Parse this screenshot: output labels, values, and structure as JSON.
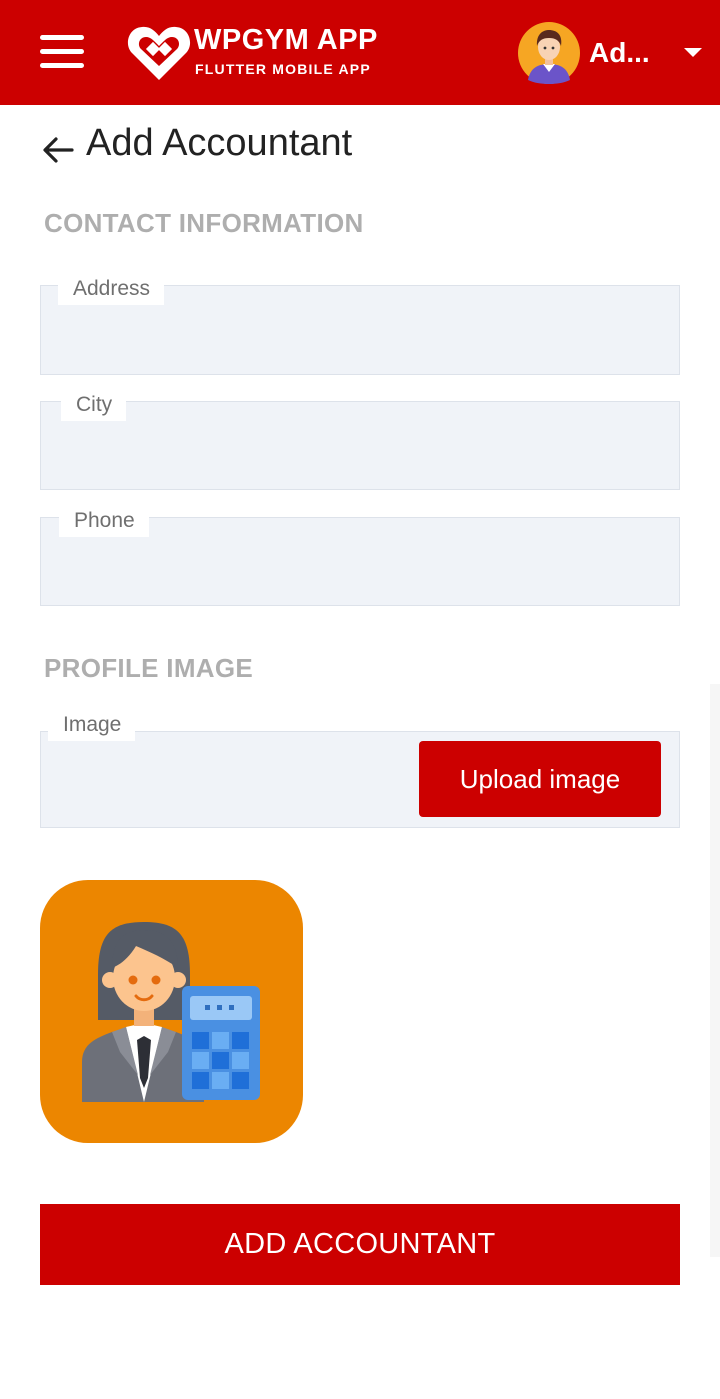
{
  "app": {
    "title": "WPGYM APP",
    "subtitle": "FLUTTER MOBILE APP",
    "brand_color": "#cc0000"
  },
  "header": {
    "menu_icon": "hamburger-menu-icon",
    "user_name": "Ad...",
    "dropdown_icon": "caret-down-icon"
  },
  "page": {
    "back_icon": "arrow-left-icon",
    "title": "Add Accountant"
  },
  "contact_section": {
    "title": "CONTACT INFORMATION",
    "fields": [
      {
        "label": "Address",
        "value": ""
      },
      {
        "label": "City",
        "value": ""
      },
      {
        "label": "Phone",
        "value": ""
      }
    ]
  },
  "profile_section": {
    "title": "PROFILE IMAGE",
    "image_field_label": "Image",
    "upload_button": "Upload image",
    "preview_icon": "accountant-avatar-icon"
  },
  "submit_button": "ADD ACCOUNTANT"
}
